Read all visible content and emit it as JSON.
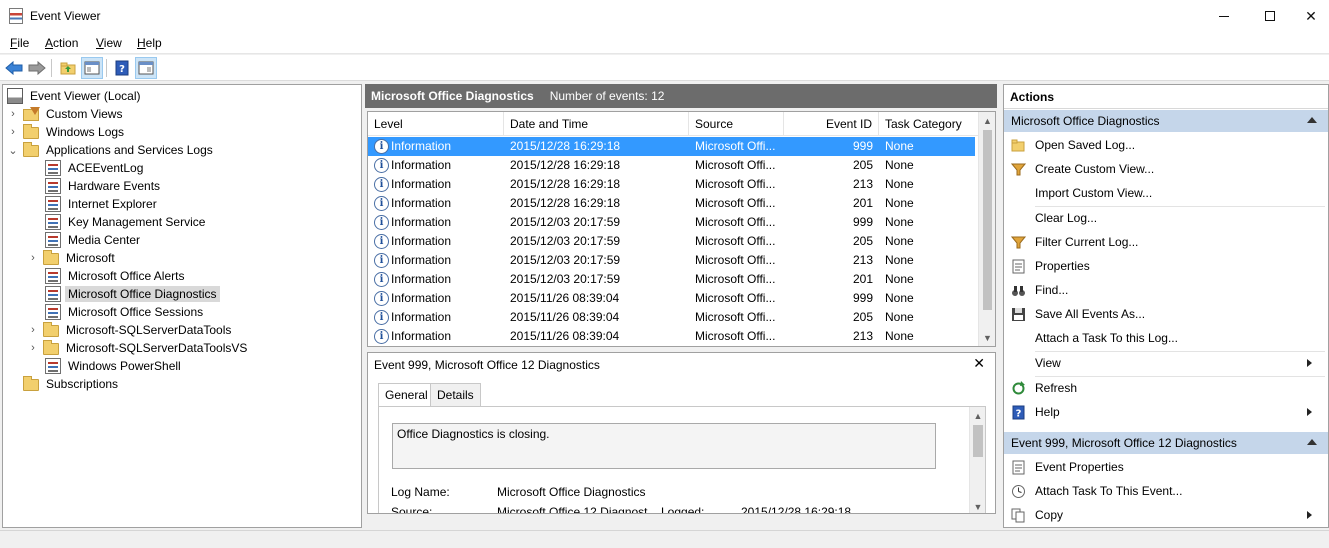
{
  "window": {
    "title": "Event Viewer"
  },
  "menu": [
    {
      "pre": "",
      "u": "F",
      "post": "ile"
    },
    {
      "pre": "",
      "u": "A",
      "post": "ction"
    },
    {
      "pre": "",
      "u": "V",
      "post": "iew"
    },
    {
      "pre": "",
      "u": "H",
      "post": "elp"
    }
  ],
  "tree": {
    "root": "Event Viewer (Local)",
    "custom_views": "Custom Views",
    "windows_logs": "Windows Logs",
    "app_services": "Applications and Services Logs",
    "children": [
      "ACEEventLog",
      "Hardware Events",
      "Internet Explorer",
      "Key Management Service",
      "Media Center",
      "Microsoft",
      "Microsoft Office Alerts",
      "Microsoft Office Diagnostics",
      "Microsoft Office Sessions",
      "Microsoft-SQLServerDataTools",
      "Microsoft-SQLServerDataToolsVS",
      "Windows PowerShell"
    ],
    "subscriptions": "Subscriptions"
  },
  "center": {
    "title": "Microsoft Office Diagnostics",
    "event_count": "Number of events: 12",
    "columns": [
      "Level",
      "Date and Time",
      "Source",
      "Event ID",
      "Task Category"
    ],
    "rows": [
      {
        "level": "Information",
        "datetime": "2015/12/28 16:29:18",
        "source": "Microsoft Offi...",
        "event_id": "999",
        "category": "None"
      },
      {
        "level": "Information",
        "datetime": "2015/12/28 16:29:18",
        "source": "Microsoft Offi...",
        "event_id": "205",
        "category": "None"
      },
      {
        "level": "Information",
        "datetime": "2015/12/28 16:29:18",
        "source": "Microsoft Offi...",
        "event_id": "213",
        "category": "None"
      },
      {
        "level": "Information",
        "datetime": "2015/12/28 16:29:18",
        "source": "Microsoft Offi...",
        "event_id": "201",
        "category": "None"
      },
      {
        "level": "Information",
        "datetime": "2015/12/03 20:17:59",
        "source": "Microsoft Offi...",
        "event_id": "999",
        "category": "None"
      },
      {
        "level": "Information",
        "datetime": "2015/12/03 20:17:59",
        "source": "Microsoft Offi...",
        "event_id": "205",
        "category": "None"
      },
      {
        "level": "Information",
        "datetime": "2015/12/03 20:17:59",
        "source": "Microsoft Offi...",
        "event_id": "213",
        "category": "None"
      },
      {
        "level": "Information",
        "datetime": "2015/12/03 20:17:59",
        "source": "Microsoft Offi...",
        "event_id": "201",
        "category": "None"
      },
      {
        "level": "Information",
        "datetime": "2015/11/26 08:39:04",
        "source": "Microsoft Offi...",
        "event_id": "999",
        "category": "None"
      },
      {
        "level": "Information",
        "datetime": "2015/11/26 08:39:04",
        "source": "Microsoft Offi...",
        "event_id": "205",
        "category": "None"
      },
      {
        "level": "Information",
        "datetime": "2015/11/26 08:39:04",
        "source": "Microsoft Offi...",
        "event_id": "213",
        "category": "None"
      }
    ]
  },
  "detail": {
    "title": "Event 999, Microsoft Office 12 Diagnostics",
    "tabs": [
      "General",
      "Details"
    ],
    "description": "Office Diagnostics is closing.",
    "log_name_label": "Log Name:",
    "log_name_value": "Microsoft Office Diagnostics",
    "source_label": "Source:",
    "source_value": "Microsoft Office 12 Diagnost",
    "logged_label": "Logged:",
    "logged_value": "2015/12/28 16:29:18"
  },
  "actions": {
    "title": "Actions",
    "section1": "Microsoft Office Diagnostics",
    "items1": [
      {
        "label": "Open Saved Log...",
        "icon": "folder-open-icon"
      },
      {
        "label": "Create Custom View...",
        "icon": "filter-icon"
      },
      {
        "label": "Import Custom View...",
        "icon": ""
      },
      {
        "label": "Clear Log...",
        "icon": ""
      },
      {
        "label": "Filter Current Log...",
        "icon": "filter-icon"
      },
      {
        "label": "Properties",
        "icon": "properties-icon"
      },
      {
        "label": "Find...",
        "icon": "binoculars-icon"
      },
      {
        "label": "Save All Events As...",
        "icon": "save-icon"
      },
      {
        "label": "Attach a Task To this Log...",
        "icon": ""
      },
      {
        "label": "View",
        "icon": ""
      },
      {
        "label": "Refresh",
        "icon": "refresh-icon"
      },
      {
        "label": "Help",
        "icon": "help-icon"
      }
    ],
    "section2": "Event 999, Microsoft Office 12 Diagnostics",
    "items2": [
      {
        "label": "Event Properties",
        "icon": "properties-icon"
      },
      {
        "label": "Attach Task To This Event...",
        "icon": "task-clock-icon"
      },
      {
        "label": "Copy",
        "icon": "copy-icon"
      }
    ]
  },
  "colors": {
    "selection": "#3399ff",
    "section_header": "#c5d6ea",
    "center_header": "#6c6c6c"
  }
}
